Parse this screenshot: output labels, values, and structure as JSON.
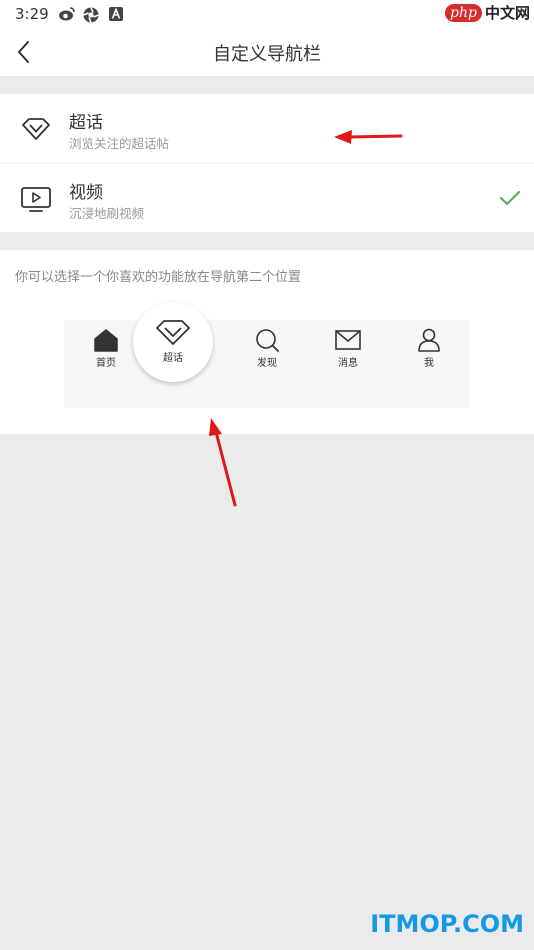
{
  "status_bar": {
    "time": "3:29",
    "watermark_php": "php",
    "watermark_cn": "中文网"
  },
  "header": {
    "title": "自定义导航栏"
  },
  "options": [
    {
      "title": "超话",
      "subtitle": "浏览关注的超话帖",
      "icon": "diamond-icon",
      "selected": false
    },
    {
      "title": "视频",
      "subtitle": "沉浸地刷视频",
      "icon": "video-play-icon",
      "selected": true
    }
  ],
  "preview": {
    "hint": "你可以选择一个你喜欢的功能放在导航第二个位置",
    "tabs": [
      {
        "label": "首页",
        "icon": "home-icon"
      },
      {
        "label": "超话",
        "icon": "diamond-icon"
      },
      {
        "label": "发现",
        "icon": "search-icon"
      },
      {
        "label": "消息",
        "icon": "mail-icon"
      },
      {
        "label": "我",
        "icon": "person-icon"
      }
    ]
  },
  "colors": {
    "accent_check": "#4caf50",
    "annotation_arrow": "#e01818",
    "background": "#ebebeb"
  },
  "watermark": "ITMOP.COM"
}
